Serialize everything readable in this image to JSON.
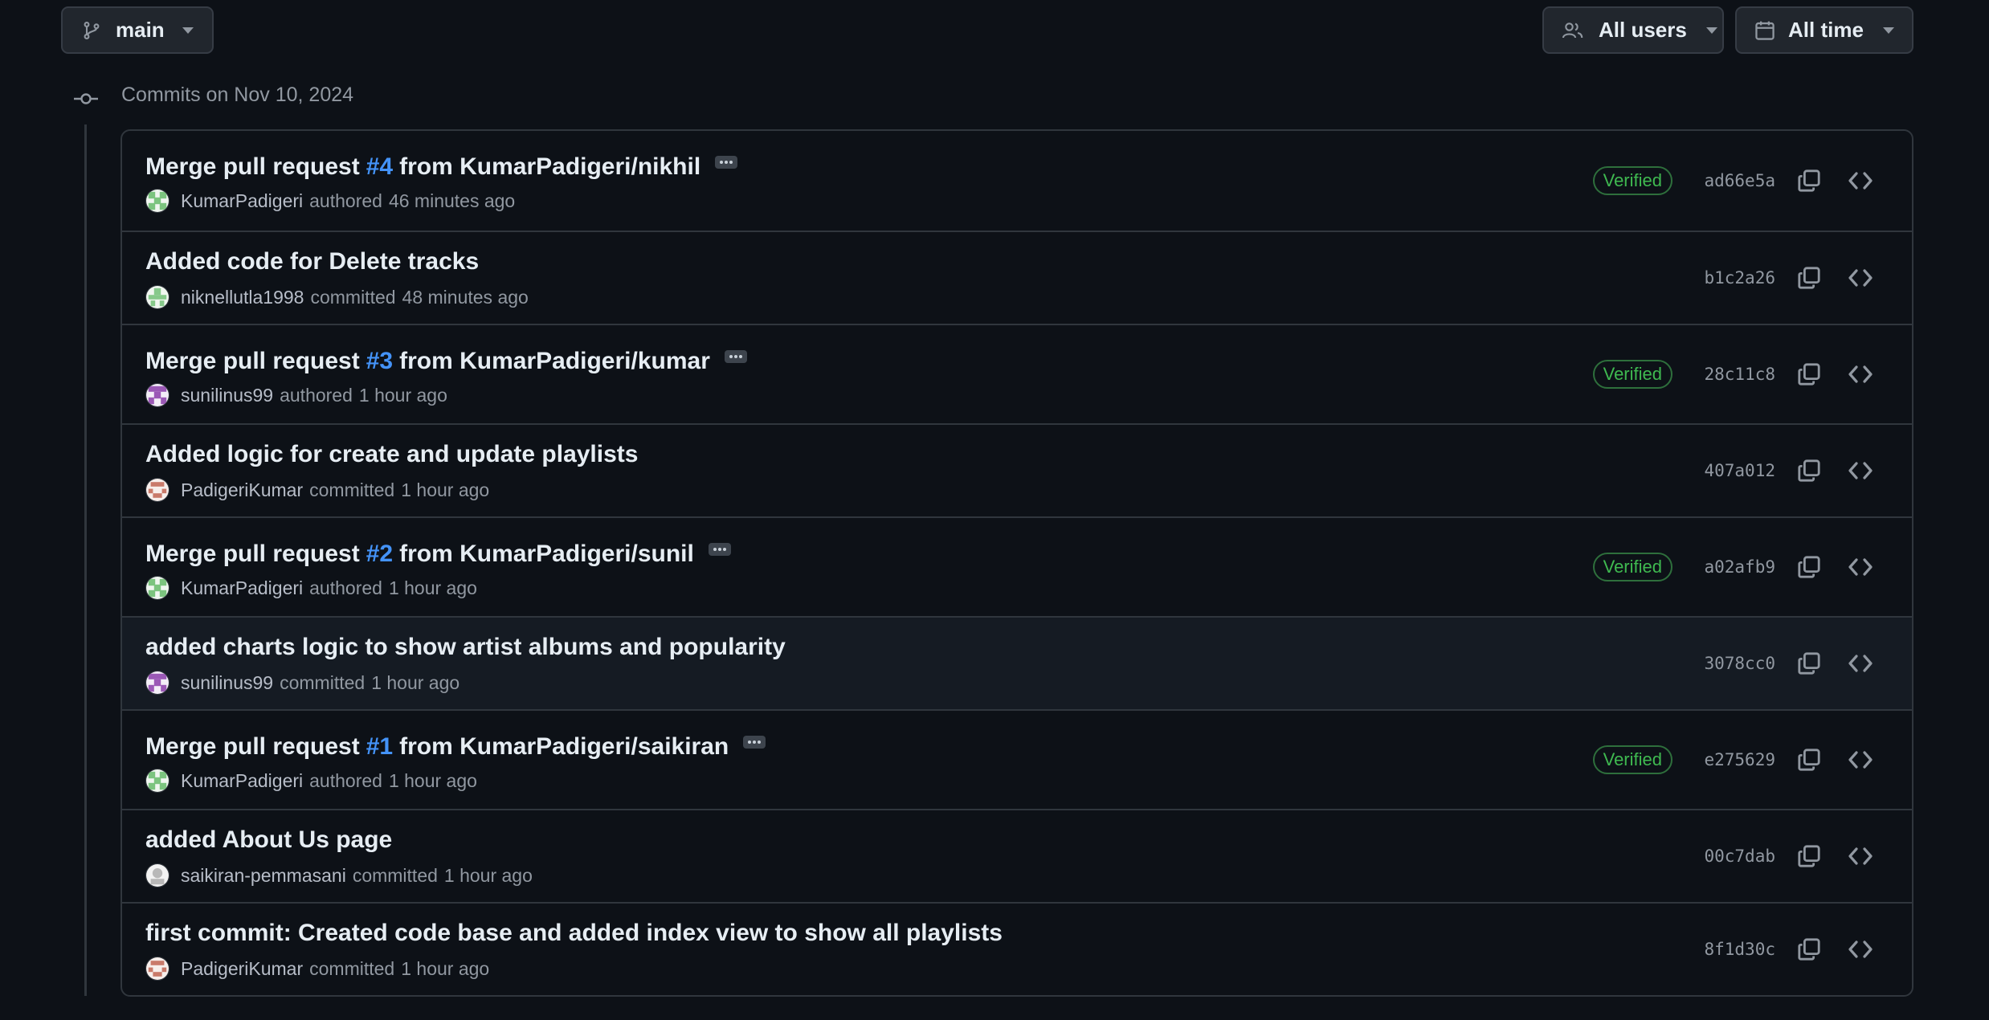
{
  "filters": {
    "branch": {
      "label": "main",
      "icon": "git-branch-icon"
    },
    "users": {
      "label": "All users",
      "icon": "people-icon"
    },
    "time": {
      "label": "All time",
      "icon": "calendar-icon"
    }
  },
  "group": {
    "title": "Commits on Nov 10, 2024"
  },
  "colors": {
    "background": "#0d1117",
    "border": "#30363d",
    "link": "#4493f8",
    "verified": "#3fb950",
    "muted": "#9198a1"
  },
  "commits": [
    {
      "title_pre": "Merge pull request ",
      "pr": "#4",
      "title_post": " from KumarPadigeri/nikhil",
      "author": "KumarPadigeri",
      "action": "authored",
      "time": "46 minutes ago",
      "verified": "Verified",
      "sha": "ad66e5a",
      "avatar": "green-identicon"
    },
    {
      "title": "Added code for Delete tracks",
      "author": "niknellutla1998",
      "action": "committed",
      "time": "48 minutes ago",
      "sha": "b1c2a26",
      "avatar": "green-identicon-alt"
    },
    {
      "title_pre": "Merge pull request ",
      "pr": "#3",
      "title_post": " from KumarPadigeri/kumar",
      "author": "sunilinus99",
      "action": "authored",
      "time": "1 hour ago",
      "verified": "Verified",
      "sha": "28c11c8",
      "avatar": "purple-identicon"
    },
    {
      "title": "Added logic for create and update playlists",
      "author": "PadigeriKumar",
      "action": "committed",
      "time": "1 hour ago",
      "sha": "407a012",
      "avatar": "red-identicon"
    },
    {
      "title_pre": "Merge pull request ",
      "pr": "#2",
      "title_post": " from KumarPadigeri/sunil",
      "author": "KumarPadigeri",
      "action": "authored",
      "time": "1 hour ago",
      "verified": "Verified",
      "sha": "a02afb9",
      "avatar": "green-identicon"
    },
    {
      "title": "added charts logic to show artist albums and popularity",
      "author": "sunilinus99",
      "action": "committed",
      "time": "1 hour ago",
      "sha": "3078cc0",
      "avatar": "purple-identicon"
    },
    {
      "title_pre": "Merge pull request ",
      "pr": "#1",
      "title_post": " from KumarPadigeri/saikiran",
      "author": "KumarPadigeri",
      "action": "authored",
      "time": "1 hour ago",
      "verified": "Verified",
      "sha": "e275629",
      "avatar": "green-identicon"
    },
    {
      "title": "added About Us page",
      "author": "saikiran-pemmasani",
      "action": "committed",
      "time": "1 hour ago",
      "sha": "00c7dab",
      "avatar": "gray-identicon"
    },
    {
      "title": "first commit: Created code base and added index view to show all playlists",
      "author": "PadigeriKumar",
      "action": "committed",
      "time": "1 hour ago",
      "sha": "8f1d30c",
      "avatar": "red-identicon"
    }
  ]
}
